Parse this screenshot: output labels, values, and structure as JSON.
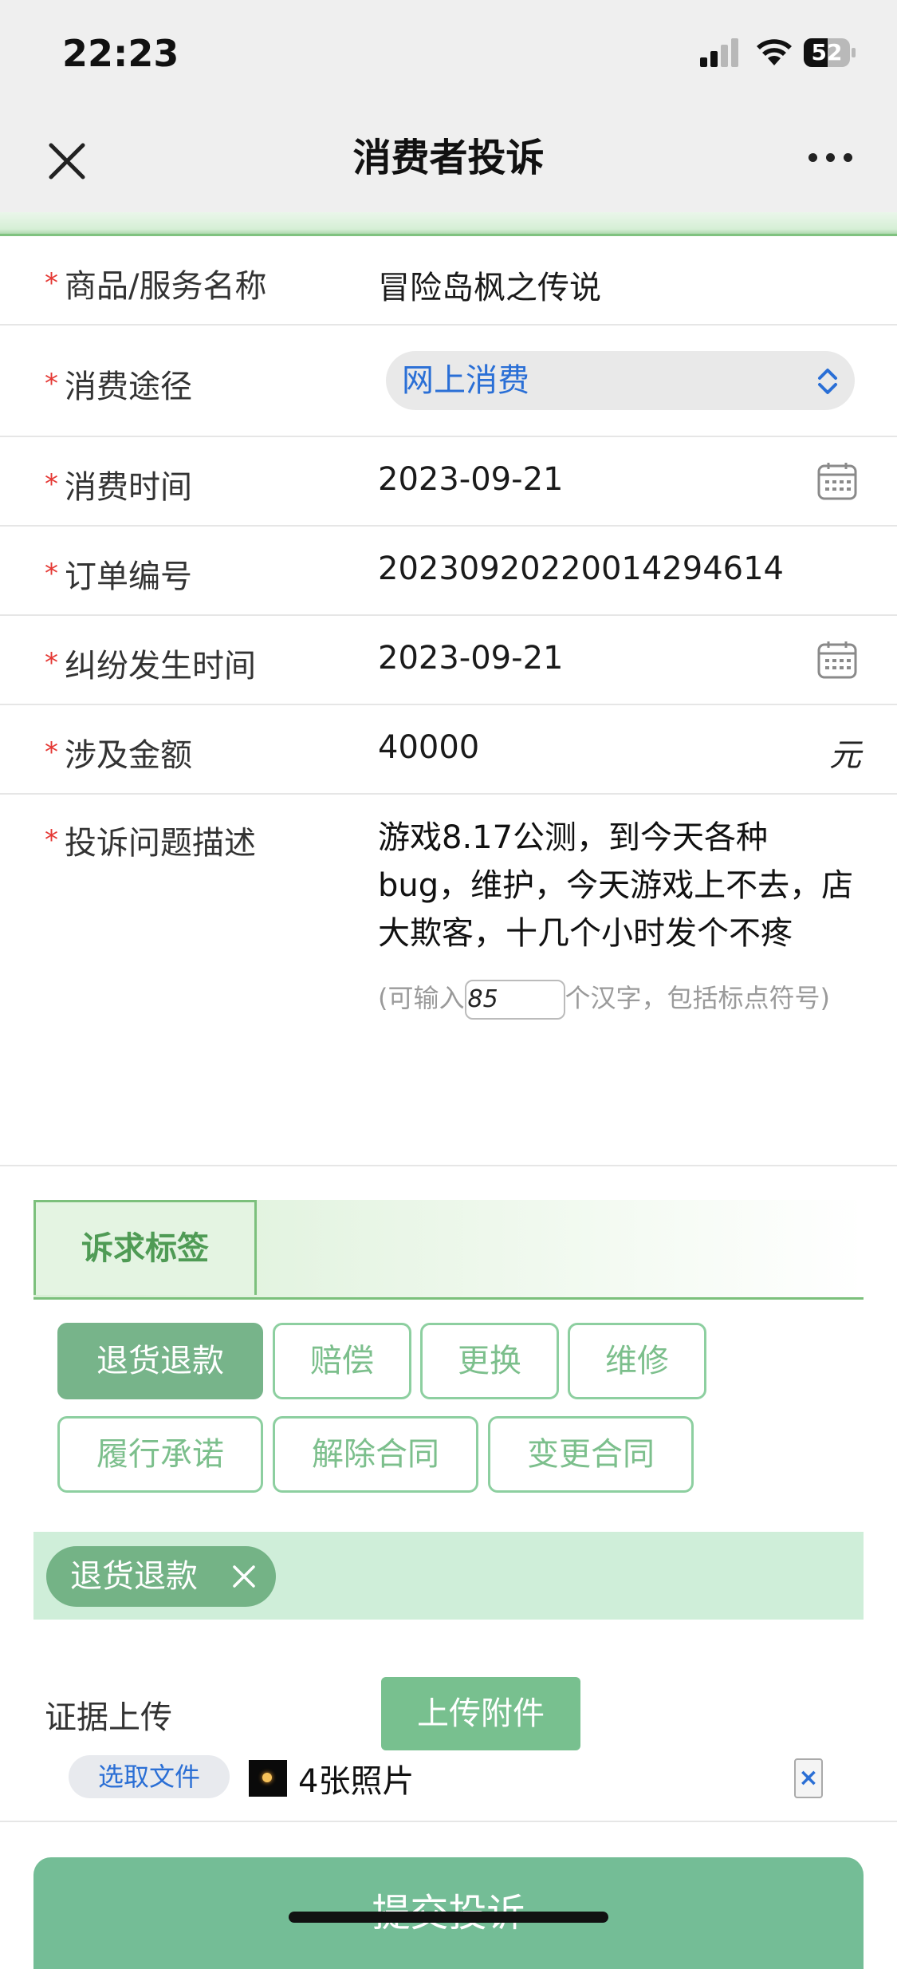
{
  "status_bar": {
    "time": "22:23",
    "battery": "52",
    "battery_level": 0.52
  },
  "nav": {
    "title": "消费者投诉"
  },
  "form": {
    "product": {
      "label": "商品/服务名称",
      "value": "冒险岛枫之传说"
    },
    "channel": {
      "label": "消费途径",
      "value": "网上消费"
    },
    "consume_time": {
      "label": "消费时间",
      "value": "2023-09-21"
    },
    "order_no": {
      "label": "订单编号",
      "value": "20230920220014294614"
    },
    "dispute_time": {
      "label": "纠纷发生时间",
      "value": "2023-09-21"
    },
    "amount": {
      "label": "涉及金额",
      "value": "40000",
      "unit": "元"
    },
    "description": {
      "label": "投诉问题描述",
      "value": "游戏8.17公测，到今天各种bug，维护，今天游戏上不去，店大欺客，十几个小时发个不疼",
      "hint_prefix": "(可输入",
      "remaining": "85",
      "hint_suffix": "个汉字，包括标点符号)"
    }
  },
  "demand": {
    "tab_label": "诉求标签",
    "tags": [
      "退货退款",
      "赔偿",
      "更换",
      "维修",
      "履行承诺",
      "解除合同",
      "变更合同"
    ],
    "selected_tag": "退货退款"
  },
  "evidence": {
    "label": "证据上传",
    "upload_button": "上传附件",
    "choose_file": "选取文件",
    "file_name": "4张照片",
    "delete": "×"
  },
  "submit_label": "提交投诉",
  "colors": {
    "accent_green": "#74bd96",
    "required_star": "#e53935",
    "link_blue": "#2a6fd6"
  }
}
